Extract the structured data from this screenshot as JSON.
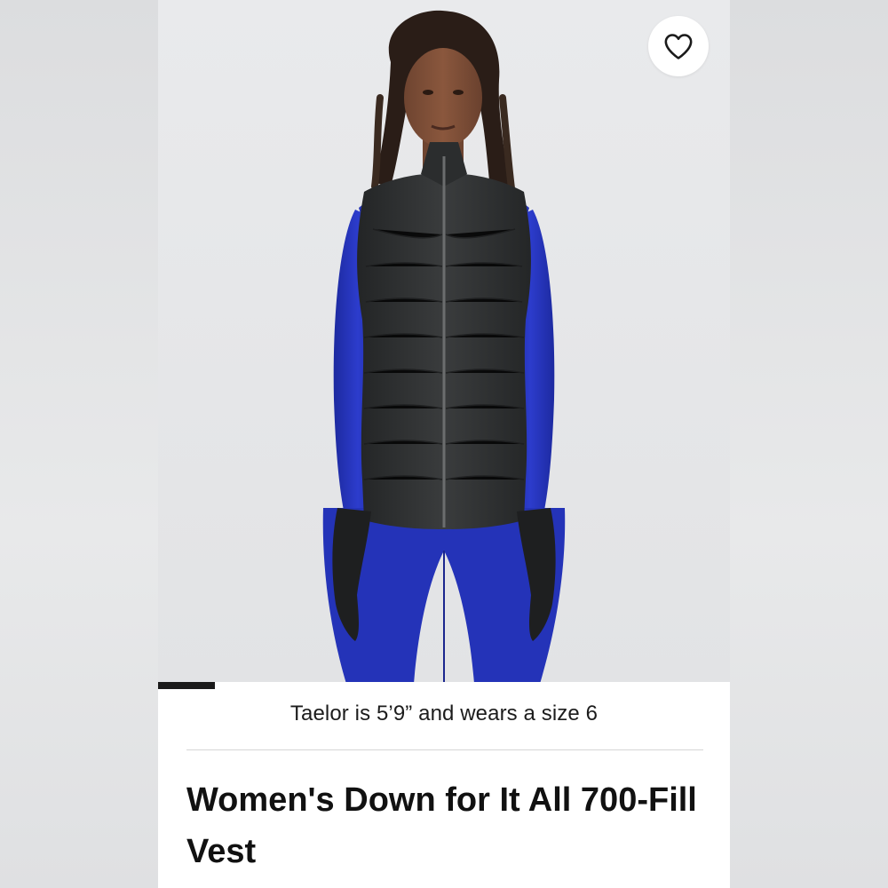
{
  "product": {
    "model_info": "Taelor is 5’9” and wears a size 6",
    "title": "Women's Down for It All 700-Fill Vest"
  },
  "hero": {
    "image_subject": "model wearing black down vest over blue long-sleeve top and blue leggings with black gloves",
    "carousel_active_index": 0
  },
  "icons": {
    "favorite": "heart-outline-icon"
  },
  "colors": {
    "vest": "#2e3031",
    "top": "#2434b8",
    "background": "#e7e8ea",
    "indicator": "#1a1a1a"
  }
}
